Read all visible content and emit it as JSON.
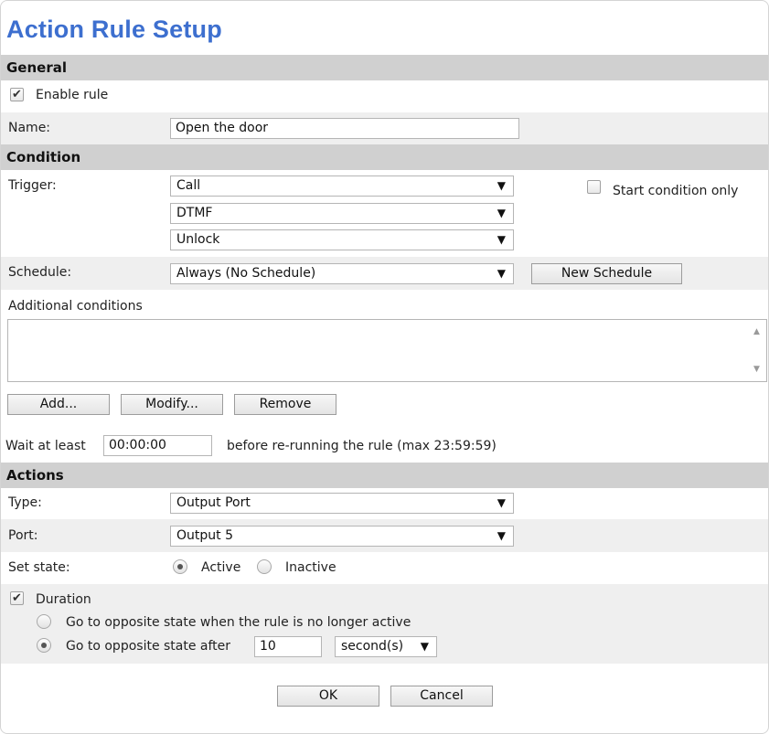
{
  "title": "Action Rule Setup",
  "general": {
    "header": "General",
    "enable_rule_label": "Enable rule",
    "enable_rule_checked": true,
    "name_label": "Name:",
    "name_value": "Open the door"
  },
  "condition": {
    "header": "Condition",
    "trigger_label": "Trigger:",
    "trigger_values": [
      "Call",
      "DTMF",
      "Unlock"
    ],
    "start_condition_only_label": "Start condition only",
    "start_condition_only_checked": false,
    "schedule_label": "Schedule:",
    "schedule_value": "Always (No Schedule)",
    "new_schedule_button": "New Schedule",
    "additional_conditions_label": "Additional conditions",
    "add_button": "Add...",
    "modify_button": "Modify...",
    "remove_button": "Remove",
    "wait_label": "Wait at least",
    "wait_value": "00:00:00",
    "wait_suffix": "before re-running the rule (max 23:59:59)"
  },
  "actions": {
    "header": "Actions",
    "type_label": "Type:",
    "type_value": "Output Port",
    "port_label": "Port:",
    "port_value": "Output 5",
    "set_state_label": "Set state:",
    "state_active_label": "Active",
    "state_inactive_label": "Inactive",
    "state_selected": "Active",
    "duration_label": "Duration",
    "duration_checked": true,
    "opposite_when_inactive_label": "Go to opposite state when the rule is no longer active",
    "opposite_after_label": "Go to opposite state after",
    "opposite_after_value": "10",
    "unit_value": "second(s)"
  },
  "footer": {
    "ok_button": "OK",
    "cancel_button": "Cancel"
  },
  "colors": {
    "title": "#3d6fcf",
    "section_header_bg": "#d0d0d0",
    "shaded_row_bg": "#efefef"
  },
  "icons": {
    "dropdown": "▼",
    "check": "✔",
    "scroll_up": "▲",
    "scroll_down": "▼"
  }
}
